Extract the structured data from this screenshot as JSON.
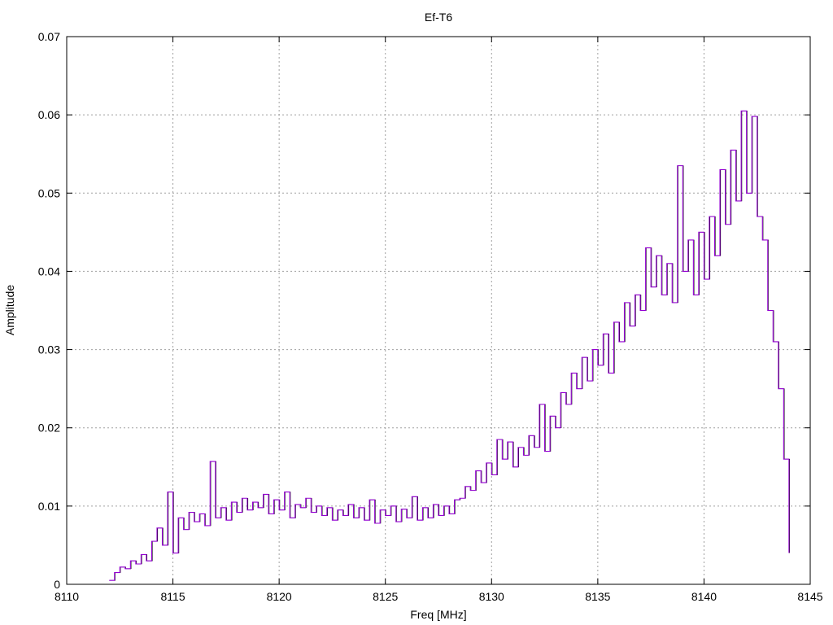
{
  "chart_data": {
    "type": "line",
    "title": "Ef-T6",
    "xlabel": "Freq [MHz]",
    "ylabel": "Amplitude",
    "xlim": [
      8110,
      8145
    ],
    "ylim": [
      0,
      0.07
    ],
    "xticks": [
      "8110",
      "8115",
      "8120",
      "8125",
      "8130",
      "8135",
      "8140",
      "8145"
    ],
    "yticks": [
      "0",
      "0.01",
      "0.02",
      "0.03",
      "0.04",
      "0.05",
      "0.06",
      "0.07"
    ],
    "grid": true,
    "series": [
      {
        "name": "Ef-T6",
        "color": "#9400d3",
        "x": [
          8112.0,
          8112.25,
          8112.5,
          8112.75,
          8113.0,
          8113.25,
          8113.5,
          8113.75,
          8114.0,
          8114.25,
          8114.5,
          8114.75,
          8115.0,
          8115.25,
          8115.5,
          8115.75,
          8116.0,
          8116.25,
          8116.5,
          8116.75,
          8117.0,
          8117.25,
          8117.5,
          8117.75,
          8118.0,
          8118.25,
          8118.5,
          8118.75,
          8119.0,
          8119.25,
          8119.5,
          8119.75,
          8120.0,
          8120.25,
          8120.5,
          8120.75,
          8121.0,
          8121.25,
          8121.5,
          8121.75,
          8122.0,
          8122.25,
          8122.5,
          8122.75,
          8123.0,
          8123.25,
          8123.5,
          8123.75,
          8124.0,
          8124.25,
          8124.5,
          8124.75,
          8125.0,
          8125.25,
          8125.5,
          8125.75,
          8126.0,
          8126.25,
          8126.5,
          8126.75,
          8127.0,
          8127.25,
          8127.5,
          8127.75,
          8128.0,
          8128.25,
          8128.5,
          8128.75,
          8129.0,
          8129.25,
          8129.5,
          8129.75,
          8130.0,
          8130.25,
          8130.5,
          8130.75,
          8131.0,
          8131.25,
          8131.5,
          8131.75,
          8132.0,
          8132.25,
          8132.5,
          8132.75,
          8133.0,
          8133.25,
          8133.5,
          8133.75,
          8134.0,
          8134.25,
          8134.5,
          8134.75,
          8135.0,
          8135.25,
          8135.5,
          8135.75,
          8136.0,
          8136.25,
          8136.5,
          8136.75,
          8137.0,
          8137.25,
          8137.5,
          8137.75,
          8138.0,
          8138.25,
          8138.5,
          8138.75,
          8139.0,
          8139.25,
          8139.5,
          8139.75,
          8140.0,
          8140.25,
          8140.5,
          8140.75,
          8141.0,
          8141.25,
          8141.5,
          8141.75,
          8142.0,
          8142.25,
          8142.5,
          8142.75,
          8143.0,
          8143.25,
          8143.5,
          8143.75,
          8144.0
        ],
        "y": [
          0.0005,
          0.0015,
          0.0022,
          0.002,
          0.003,
          0.0026,
          0.0038,
          0.003,
          0.0055,
          0.0072,
          0.005,
          0.0118,
          0.004,
          0.0085,
          0.007,
          0.0092,
          0.008,
          0.009,
          0.0075,
          0.0157,
          0.0085,
          0.0098,
          0.0082,
          0.0105,
          0.0092,
          0.011,
          0.0095,
          0.0105,
          0.0098,
          0.0115,
          0.009,
          0.0108,
          0.0095,
          0.0118,
          0.0085,
          0.0102,
          0.0098,
          0.011,
          0.0092,
          0.01,
          0.0088,
          0.0098,
          0.0082,
          0.0095,
          0.0088,
          0.0102,
          0.0085,
          0.0098,
          0.0082,
          0.0108,
          0.0078,
          0.0095,
          0.0088,
          0.01,
          0.008,
          0.0096,
          0.0085,
          0.0112,
          0.0082,
          0.0098,
          0.0085,
          0.0102,
          0.0088,
          0.01,
          0.009,
          0.0108,
          0.011,
          0.0125,
          0.012,
          0.0145,
          0.013,
          0.0155,
          0.014,
          0.0185,
          0.016,
          0.0182,
          0.015,
          0.0175,
          0.0165,
          0.019,
          0.0175,
          0.023,
          0.017,
          0.0215,
          0.02,
          0.0245,
          0.023,
          0.027,
          0.025,
          0.029,
          0.026,
          0.03,
          0.028,
          0.032,
          0.027,
          0.0335,
          0.031,
          0.036,
          0.033,
          0.037,
          0.035,
          0.043,
          0.038,
          0.042,
          0.037,
          0.041,
          0.036,
          0.0535,
          0.04,
          0.044,
          0.037,
          0.045,
          0.039,
          0.047,
          0.042,
          0.053,
          0.046,
          0.0555,
          0.049,
          0.0605,
          0.05,
          0.0598,
          0.047,
          0.044,
          0.035,
          0.031,
          0.025,
          0.016,
          0.004
        ]
      }
    ]
  }
}
